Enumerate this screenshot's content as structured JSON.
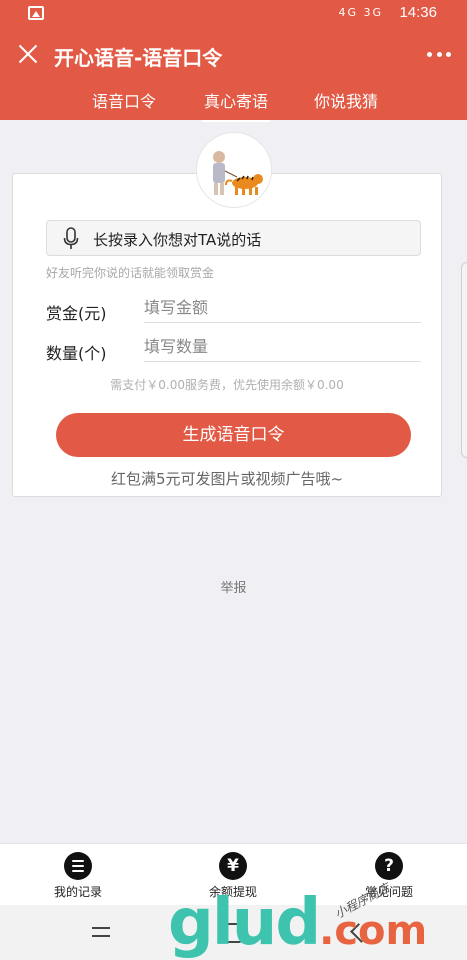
{
  "status_bar": {
    "time": "14:36",
    "network_labels": "4G  3G"
  },
  "header": {
    "title": "开心语音-语音口令",
    "tabs": [
      {
        "label": "语音口令",
        "active": false
      },
      {
        "label": "真心寄语",
        "active": true
      },
      {
        "label": "你说我猜",
        "active": false
      }
    ]
  },
  "form": {
    "record_label": "长按录入你想对TA说的话",
    "hint": "好友听完你说的话就能领取赏金",
    "reward": {
      "label": "赏金(元)",
      "placeholder": "填写金额"
    },
    "quantity": {
      "label": "数量(个)",
      "placeholder": "填写数量"
    },
    "fee_text": "需支付￥0.00服务费，优先使用余额￥0.00",
    "generate_button": "生成语音口令",
    "tip": "红包满5元可发图片或视频广告哦~"
  },
  "report_link": "举报",
  "tabbar": {
    "items": [
      {
        "label": "我的记录",
        "icon": "list-icon"
      },
      {
        "label": "余额提现",
        "icon": "yen-icon",
        "symbol": "¥"
      },
      {
        "label": "常见问题",
        "icon": "question-icon",
        "symbol": "?"
      }
    ]
  },
  "watermark": {
    "brand_main": "glud",
    "brand_suffix": ".com",
    "stamp": "小程序商店"
  },
  "colors": {
    "accent": "#e25a45",
    "background": "#efeff4"
  }
}
